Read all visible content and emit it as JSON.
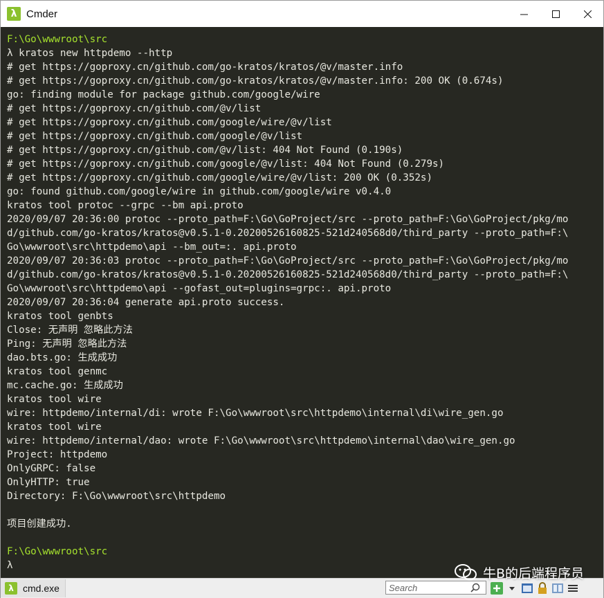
{
  "window": {
    "title": "Cmder",
    "app_icon": "lambda-icon",
    "controls": [
      "minimize-icon",
      "maximize-icon",
      "close-icon"
    ]
  },
  "terminal": {
    "lines": [
      {
        "text": "F:\\Go\\wwwroot\\src",
        "kind": "path"
      },
      {
        "text": "λ kratos new httpdemo --http"
      },
      {
        "text": "# get https://goproxy.cn/github.com/go-kratos/kratos/@v/master.info"
      },
      {
        "text": "# get https://goproxy.cn/github.com/go-kratos/kratos/@v/master.info: 200 OK (0.674s)"
      },
      {
        "text": "go: finding module for package github.com/google/wire"
      },
      {
        "text": "# get https://goproxy.cn/github.com/@v/list"
      },
      {
        "text": "# get https://goproxy.cn/github.com/google/wire/@v/list"
      },
      {
        "text": "# get https://goproxy.cn/github.com/google/@v/list"
      },
      {
        "text": "# get https://goproxy.cn/github.com/@v/list: 404 Not Found (0.190s)"
      },
      {
        "text": "# get https://goproxy.cn/github.com/google/@v/list: 404 Not Found (0.279s)"
      },
      {
        "text": "# get https://goproxy.cn/github.com/google/wire/@v/list: 200 OK (0.352s)"
      },
      {
        "text": "go: found github.com/google/wire in github.com/google/wire v0.4.0"
      },
      {
        "text": "kratos tool protoc --grpc --bm api.proto"
      },
      {
        "text": "2020/09/07 20:36:00 protoc --proto_path=F:\\Go\\GoProject/src --proto_path=F:\\Go\\GoProject/pkg/mo"
      },
      {
        "text": "d/github.com/go-kratos/kratos@v0.5.1-0.20200526160825-521d240568d0/third_party --proto_path=F:\\"
      },
      {
        "text": "Go\\wwwroot\\src\\httpdemo\\api --bm_out=:. api.proto"
      },
      {
        "text": "2020/09/07 20:36:03 protoc --proto_path=F:\\Go\\GoProject/src --proto_path=F:\\Go\\GoProject/pkg/mo"
      },
      {
        "text": "d/github.com/go-kratos/kratos@v0.5.1-0.20200526160825-521d240568d0/third_party --proto_path=F:\\"
      },
      {
        "text": "Go\\wwwroot\\src\\httpdemo\\api --gofast_out=plugins=grpc:. api.proto"
      },
      {
        "text": "2020/09/07 20:36:04 generate api.proto success."
      },
      {
        "text": "kratos tool genbts"
      },
      {
        "text": "Close: 无声明 忽略此方法"
      },
      {
        "text": "Ping: 无声明 忽略此方法"
      },
      {
        "text": "dao.bts.go: 生成成功"
      },
      {
        "text": "kratos tool genmc"
      },
      {
        "text": "mc.cache.go: 生成成功"
      },
      {
        "text": "kratos tool wire"
      },
      {
        "text": "wire: httpdemo/internal/di: wrote F:\\Go\\wwwroot\\src\\httpdemo\\internal\\di\\wire_gen.go"
      },
      {
        "text": "kratos tool wire"
      },
      {
        "text": "wire: httpdemo/internal/dao: wrote F:\\Go\\wwwroot\\src\\httpdemo\\internal\\dao\\wire_gen.go"
      },
      {
        "text": "Project: httpdemo"
      },
      {
        "text": "OnlyGRPC: false"
      },
      {
        "text": "OnlyHTTP: true"
      },
      {
        "text": "Directory: F:\\Go\\wwwroot\\src\\httpdemo"
      },
      {
        "text": "",
        "kind": "blank"
      },
      {
        "text": "项目创建成功."
      },
      {
        "text": "",
        "kind": "blank"
      },
      {
        "text": "F:\\Go\\wwwroot\\src",
        "kind": "path"
      },
      {
        "text": "λ"
      }
    ]
  },
  "statusbar": {
    "tab_label": "cmd.exe",
    "search_placeholder": "Search",
    "tool_icons": [
      "add-tab-icon",
      "dropdown-icon",
      "console-icon",
      "lock-icon",
      "panels-icon",
      "menu-icon"
    ]
  },
  "watermark": {
    "text": "牛B的后端程序员"
  },
  "colors": {
    "terminal_bg": "#272822",
    "text": "#e8e8e0",
    "path": "#a6e22e",
    "cmder_green": "#8bc12e"
  }
}
